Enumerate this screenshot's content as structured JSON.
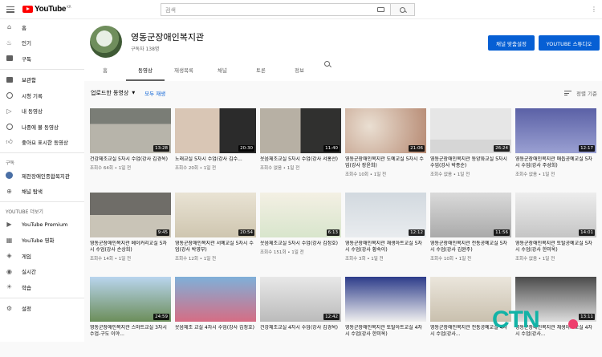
{
  "header": {
    "logo_text": "YouTube",
    "logo_kr": "KR",
    "search_placeholder": "검색",
    "right_icons": "⋮"
  },
  "sidebar": {
    "main": [
      {
        "label": "홈",
        "icon": "home-icon"
      },
      {
        "label": "인기",
        "icon": "fire-icon"
      },
      {
        "label": "구독",
        "icon": "subscriptions-icon"
      }
    ],
    "library": [
      {
        "label": "보관함",
        "icon": "library-icon"
      },
      {
        "label": "시청 기록",
        "icon": "history-icon"
      },
      {
        "label": "내 동영상",
        "icon": "my-videos-icon"
      },
      {
        "label": "나중에 볼 동영상",
        "icon": "watch-later-icon"
      },
      {
        "label": "좋아요 표시한 동영상",
        "icon": "like-icon"
      }
    ],
    "subs_heading": "구독",
    "subscriptions": [
      {
        "label": "제천장애인종합복지관",
        "icon": "channel-avatar"
      },
      {
        "label": "채널 탐색",
        "icon": "browse-channels-icon"
      }
    ],
    "more_heading": "YOUTUBE 더보기",
    "more": [
      {
        "label": "YouTube Premium",
        "icon": "premium-icon"
      },
      {
        "label": "YouTube 영화",
        "icon": "movies-icon"
      },
      {
        "label": "게임",
        "icon": "gaming-icon"
      },
      {
        "label": "실시간",
        "icon": "live-icon"
      },
      {
        "label": "학습",
        "icon": "learning-icon"
      }
    ],
    "settings": {
      "label": "설정",
      "icon": "settings-icon"
    }
  },
  "channel": {
    "name": "영동군장애인복지관",
    "subscribers": "구독자 138명",
    "customize_button": "채널 맞춤설정",
    "studio_button": "YOUTUBE 스튜디오",
    "tabs": [
      "홈",
      "동영상",
      "재생목록",
      "채널",
      "토론",
      "정보"
    ],
    "active_tab": "동영상"
  },
  "filter": {
    "label": "업로드한 동영상",
    "play_all": "모두 재생",
    "sort_label": "정렬 기준"
  },
  "videos": [
    {
      "title": "건강체조교실 5차시 수업(강사 김경옥)",
      "meta": "조회수 64회 • 1일 전",
      "duration": "13:28"
    },
    {
      "title": "노래교실 5차시 수업(강사 김수...",
      "meta": "조회수 20회 • 1일 전",
      "duration": "20:30"
    },
    {
      "title": "웃음체조교실 5차시 수업(강사 서홍선)",
      "meta": "조회수 없음 • 1일 전",
      "duration": "11:40"
    },
    {
      "title": "영동군장애인복지관 도예교실 5차시 수업(강사 장윤희)",
      "meta": "조회수 10회 • 1일 전",
      "duration": "21:06"
    },
    {
      "title": "영동군장애인복지관 동양화교실 5차시 수업(강사 박종순)",
      "meta": "조회수 없음 • 1일 전",
      "duration": "26:24"
    },
    {
      "title": "영동군장애인복지관 매듭공예교실 5차시 수업(강사 주성희)",
      "meta": "조회수 없음 • 1일 전",
      "duration": "12:17"
    },
    {
      "title": "영동군장애인복지관 베이커리교실 5차시 수업(강사 손상희)",
      "meta": "조회수 14회 • 1일 전",
      "duration": "9:45"
    },
    {
      "title": "영동군장애인복지관 서예교실 5차시 수업(강사 박영부)",
      "meta": "조회수 12회 • 1일 전",
      "duration": "20:54"
    },
    {
      "title": "웃음체조교실 5차시 수업(강사 김정호)",
      "meta": "조회수 151회 • 1일 전",
      "duration": "6:13"
    },
    {
      "title": "영동군장애인복지관 채생아트교실 5차시 수업(강사 황숙이)",
      "meta": "조회수 3회 • 1일 전",
      "duration": "12:12"
    },
    {
      "title": "영동군장애인복지관 전통공예교실 5차시 수업(강사 김완주)",
      "meta": "조회수 10회 • 1일 전",
      "duration": "11:56"
    },
    {
      "title": "영동군장애인복지관 토탈공예교실 5차시 수업(강사 한미옥)",
      "meta": "조회수 없음 • 1일 전",
      "duration": "14:01"
    },
    {
      "title": "영동군장애인복지관 스마트교실 3차시 수업-구도 이야...",
      "meta": "",
      "duration": "24:59"
    },
    {
      "title": "웃음체조 교실 4차시 수업(강사 김정호)",
      "meta": "",
      "duration": ""
    },
    {
      "title": "건강체조교실 4차시 수업(강사 김경옥)",
      "meta": "",
      "duration": "12:42"
    },
    {
      "title": "영동군장애인복지관 토탈아트교실 4차시 수업(강사 한미옥)",
      "meta": "",
      "duration": ""
    },
    {
      "title": "영동군장애인복지관 전통공예교실 4차시 수업(강사...",
      "meta": "",
      "duration": ""
    },
    {
      "title": "영동군장애인복지관 채생아트교실 4차시 수업(강사...",
      "meta": "",
      "duration": "13:11"
    }
  ],
  "watermark": {
    "text": "CTN"
  }
}
